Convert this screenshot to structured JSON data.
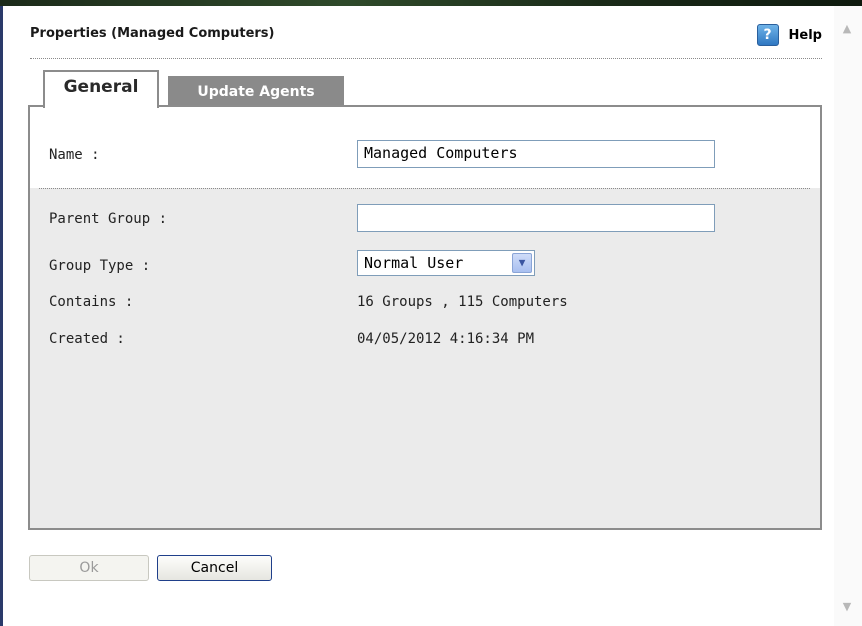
{
  "dialog": {
    "title": "Properties (Managed Computers)",
    "help_label": "Help",
    "help_icon": "?"
  },
  "tabs": [
    {
      "label": "General",
      "active": true
    },
    {
      "label": "Update Agents",
      "active": false
    }
  ],
  "form": {
    "name_label": "Name :",
    "name_value": "Managed Computers",
    "parent_label": "Parent Group :",
    "parent_value": "",
    "group_type_label": "Group Type :",
    "group_type_value": "Normal User",
    "contains_label": "Contains :",
    "contains_value": "16 Groups , 115 Computers",
    "created_label": "Created :",
    "created_value": "04/05/2012 4:16:34 PM"
  },
  "buttons": {
    "ok": "Ok",
    "cancel": "Cancel"
  },
  "icons": {
    "help": "help-icon",
    "dropdown": "chevron-down-icon",
    "scroll_up": "scroll-up-icon",
    "scroll_down": "scroll-down-icon"
  },
  "colors": {
    "tab_inactive": "#8a8a8a",
    "panel_bg": "#ebebeb",
    "border": "#8c8c8c",
    "input_border": "#7f9db9"
  }
}
